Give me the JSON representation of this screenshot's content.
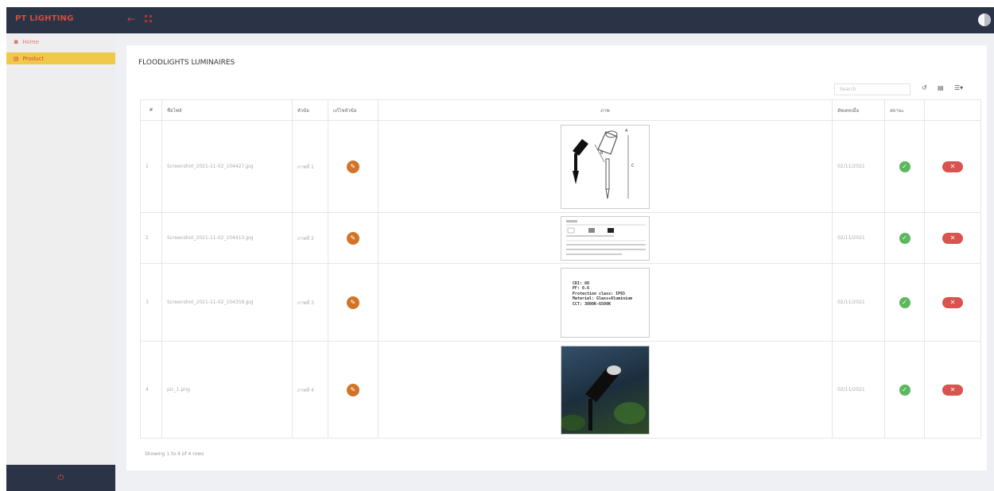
{
  "app": {
    "brand": "PT LIGHTING"
  },
  "sidebar": {
    "items": [
      {
        "label": "Home"
      },
      {
        "label": "Product"
      }
    ]
  },
  "page": {
    "title": "FLOODLIGHTS LUMINAIRES"
  },
  "toolbar": {
    "search_placeholder": "Search"
  },
  "table": {
    "headers": {
      "index": "#",
      "filename": "ชื่อไฟล์",
      "topic": "หัวข้อ",
      "edit": "แก้ไขหัวข้อ",
      "image": "ภาพ",
      "updated": "อัพเดทเมื่อ",
      "status": "สถานะ"
    },
    "rows": [
      {
        "index": "1",
        "filename": "Screenshot_2021-11-02_104427.jpg",
        "topic": "ภาพที่ 1",
        "date": "02/11/2021"
      },
      {
        "index": "2",
        "filename": "Screenshot_2021-11-02_104413.jpg",
        "topic": "ภาพที่ 2",
        "date": "02/11/2021"
      },
      {
        "index": "3",
        "filename": "Screenshot_2021-11-02_104359.jpg",
        "topic": "ภาพที่ 3",
        "date": "02/11/2021"
      },
      {
        "index": "4",
        "filename": "pic_1.png",
        "topic": "ภาพที่ 4",
        "date": "02/11/2021"
      }
    ],
    "spec_lines": [
      "CRI: 80",
      "PF: 0.6",
      "Protection class: IP65",
      "Material: Glass+Aluminium",
      "CCT: 3000K-6500K"
    ]
  },
  "footer": {
    "pagination": "Showing 1 to 4 of 4 rows"
  },
  "colors": {
    "topbar": "#2b3346",
    "brand": "#d94a3c",
    "active_item": "#efc94c",
    "edit": "#d27427",
    "status_ok": "#5cb85c",
    "delete": "#d9534f"
  },
  "icons": {
    "back": "arrow-left-icon",
    "apps": "grid-icon",
    "user": "avatar-icon",
    "home": "home-icon",
    "product": "table-icon",
    "power": "power-icon",
    "refresh": "refresh-icon",
    "columns": "columns-icon",
    "list": "list-icon",
    "edit": "pencil-icon",
    "ok": "check-icon",
    "delete": "close-icon"
  }
}
